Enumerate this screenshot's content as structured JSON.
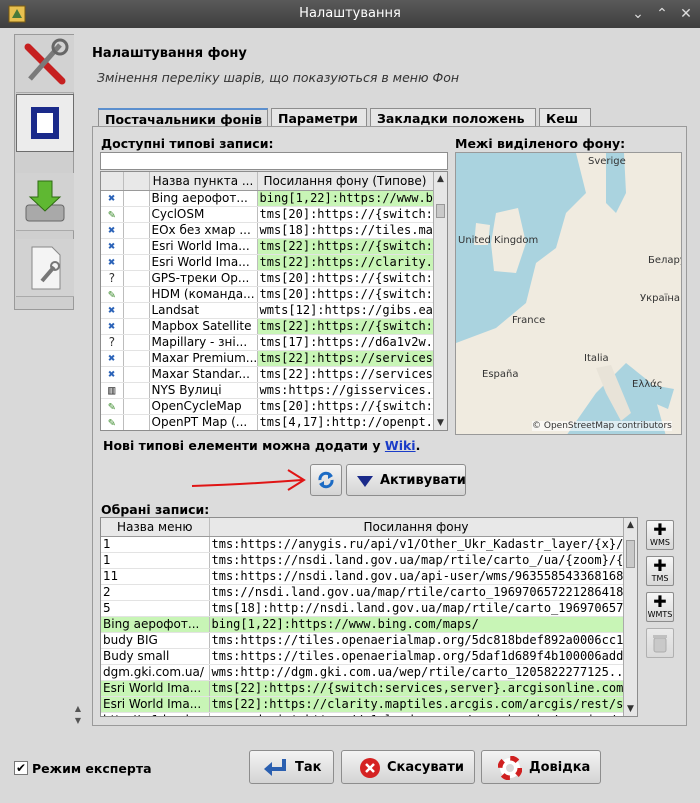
{
  "window": {
    "title": "Налаштування"
  },
  "header": {
    "title": "Налаштування фону",
    "subtitle": "Змінення переліку шарів, що показуються в меню Фон"
  },
  "tabs": [
    {
      "label": "Постачальники фонів"
    },
    {
      "label": "Параметри"
    },
    {
      "label": "Закладки положень"
    },
    {
      "label": "Кеш"
    }
  ],
  "available": {
    "label": "Доступні типові записи:",
    "filter_value": "",
    "columns": [
      "",
      "",
      "Назва пункта ...",
      "Посилання фону (Типове)"
    ],
    "rows": [
      {
        "icon": "✖",
        "name": "Bing аерофот...",
        "url": "bing[1,22]:https://www.bi...",
        "green": true
      },
      {
        "icon": "✎",
        "name": "CyclOSM",
        "url": "tms[20]:https://{switch:a...",
        "green": false
      },
      {
        "icon": "✖",
        "name": "EOx без хмар ...",
        "url": "wms[18]:https://tiles.ma...",
        "green": false
      },
      {
        "icon": "✖",
        "name": "Esri World Ima...",
        "url": "tms[22]:https://{switch:s...",
        "green": true
      },
      {
        "icon": "✖",
        "name": "Esri World Ima...",
        "url": "tms[22]:https://clarity.m...",
        "green": true
      },
      {
        "icon": "?",
        "name": "GPS-треки Op...",
        "url": "tms[20]:https://{switch:a...",
        "green": false
      },
      {
        "icon": "✎",
        "name": "HDM (команда...",
        "url": "tms[20]:https://{switch:a...",
        "green": false
      },
      {
        "icon": "✖",
        "name": "Landsat",
        "url": "wmts[12]:https://gibs.ea...",
        "green": false
      },
      {
        "icon": "✖",
        "name": "Mapbox Satellite",
        "url": "tms[22]:https://{switch:a...",
        "green": true
      },
      {
        "icon": "?",
        "name": "Mapillary - зні...",
        "url": "tms[17]:https://d6a1v2w...",
        "green": false
      },
      {
        "icon": "✖",
        "name": "Maxar Premium...",
        "url": "tms[22]:https://services....",
        "green": true
      },
      {
        "icon": "✖",
        "name": "Maxar Standar...",
        "url": "tms[22]:https://services....",
        "green": false
      },
      {
        "icon": "▥",
        "name": "NYS Вулиці",
        "url": "wms:https://gisservices.it...",
        "green": false
      },
      {
        "icon": "✎",
        "name": "OpenCycleMap",
        "url": "tms[20]:https://{switch:a...",
        "green": false
      },
      {
        "icon": "✎",
        "name": "OpenPT Map (...",
        "url": "tms[4,17]:http://openpt...",
        "green": false
      }
    ]
  },
  "bounds": {
    "label": "Межі виділеного фону:",
    "map_labels": [
      "Sverige",
      "United Kingdom",
      "Беларусь",
      "Україна",
      "France",
      "Italia",
      "España",
      "Ελλάς"
    ],
    "attribution": "© OpenStreetMap contributors"
  },
  "wiki": {
    "text": "Нові типові елементи можна додати у ",
    "link": "Wiki",
    "suffix": "."
  },
  "activate_button": {
    "label": "Активувати"
  },
  "selected": {
    "label": "Обрані записи:",
    "columns": [
      "Назва меню",
      "Посилання фону"
    ],
    "rows": [
      {
        "name": "1",
        "url": "tms:https://anygis.ru/api/v1/Other_Ukr_Kadastr_layer/{x}/{y}/{z...",
        "green": false
      },
      {
        "name": "1",
        "url": "tms:https://nsdi.land.gov.ua/map/rtile/carto_/ua/{zoom}/{x}/{...",
        "green": false
      },
      {
        "name": "11",
        "url": "tms:https://nsdi.land.gov.ua/api-user/wms/9635585433681688?...",
        "green": false
      },
      {
        "name": "2",
        "url": "tms://nsdi.land.gov.ua/map/rtile/carto_196970657221286418/...",
        "green": false
      },
      {
        "name": "5",
        "url": "tms[18]:http://nsdi.land.gov.ua/map/rtile/carto_19697065722l...",
        "green": false
      },
      {
        "name": "Bing аерофот...",
        "url": "bing[1,22]:https://www.bing.com/maps/",
        "green": true
      },
      {
        "name": "budy BIG",
        "url": "tms:https://tiles.openaerialmap.org/5dc818bdef892a0006cc15...",
        "green": false
      },
      {
        "name": "Budy small",
        "url": "tms:https://tiles.openaerialmap.org/5daf1d689f4b100006add9f...",
        "green": false
      },
      {
        "name": "dgm.gki.com.ua/",
        "url": "wms:http://dgm.gki.com.ua/wep/rtile/carto_1205822277125...",
        "green": false
      },
      {
        "name": "Esri World Ima...",
        "url": "tms[22]:https://{switch:services,server}.arcgisonline.com/arcgis...",
        "green": true
      },
      {
        "name": "Esri World Ima...",
        "url": "tms[22]:https://clarity.maptiles.arcgis.com/arcgis/rest/services/...",
        "green": true
      },
      {
        "name": "http://m1.land...",
        "url": "wms-endpoint:https://m1.land.gov.ua/geowebcache/service/wms",
        "green": false
      }
    ]
  },
  "side_buttons": [
    {
      "label": "WMS"
    },
    {
      "label": "TMS"
    },
    {
      "label": "WMTS"
    }
  ],
  "footer": {
    "expert_mode": {
      "label": "Режим експерта",
      "checked": true
    },
    "ok": "Так",
    "cancel": "Скасувати",
    "help": "Довідка"
  }
}
